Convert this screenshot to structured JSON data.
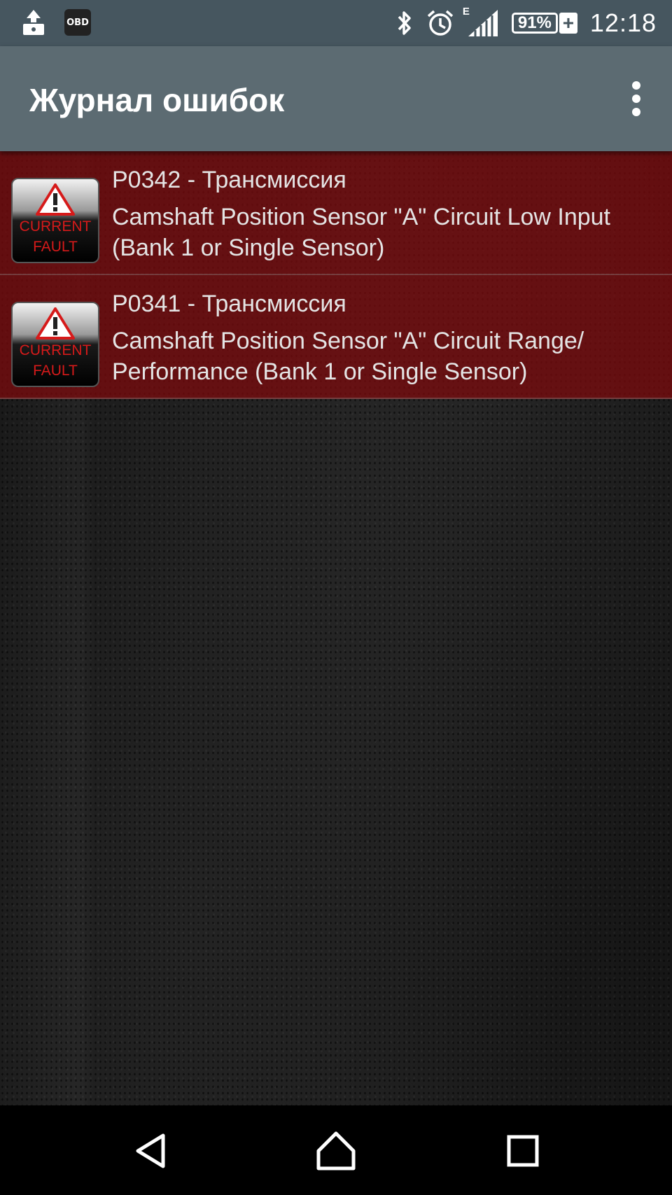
{
  "status_bar": {
    "battery_percent": "91%",
    "battery_charging_symbol": "+",
    "time": "12:18",
    "network_type": "E",
    "obd_label": "OBD",
    "icons": [
      "upload-icon",
      "obd-icon",
      "bluetooth-icon",
      "alarm-icon",
      "signal-icon",
      "battery-icon"
    ]
  },
  "app_bar": {
    "title": "Журнал ошибок",
    "menu_icon": "overflow-menu-icon"
  },
  "faults": [
    {
      "code": "P0342 - Трансмиссия",
      "description": "Camshaft Position Sensor \"A\" Circuit Low Input (Bank 1 or Single Sensor)",
      "badge_line1": "CURRENT",
      "badge_line2": "FAULT"
    },
    {
      "code": "P0341 - Трансмиссия",
      "description": "Camshaft Position Sensor \"A\" Circuit Range/ Performance (Bank 1 or Single Sensor)",
      "badge_line1": "CURRENT",
      "badge_line2": "FAULT"
    }
  ],
  "nav_bar": {
    "icons": [
      "back-icon",
      "home-icon",
      "recent-apps-icon"
    ]
  },
  "colors": {
    "status_bar": "#46565f",
    "app_bar": "#5c6b72",
    "fault_row": "#800a0c",
    "badge_text": "#d61a1a"
  }
}
